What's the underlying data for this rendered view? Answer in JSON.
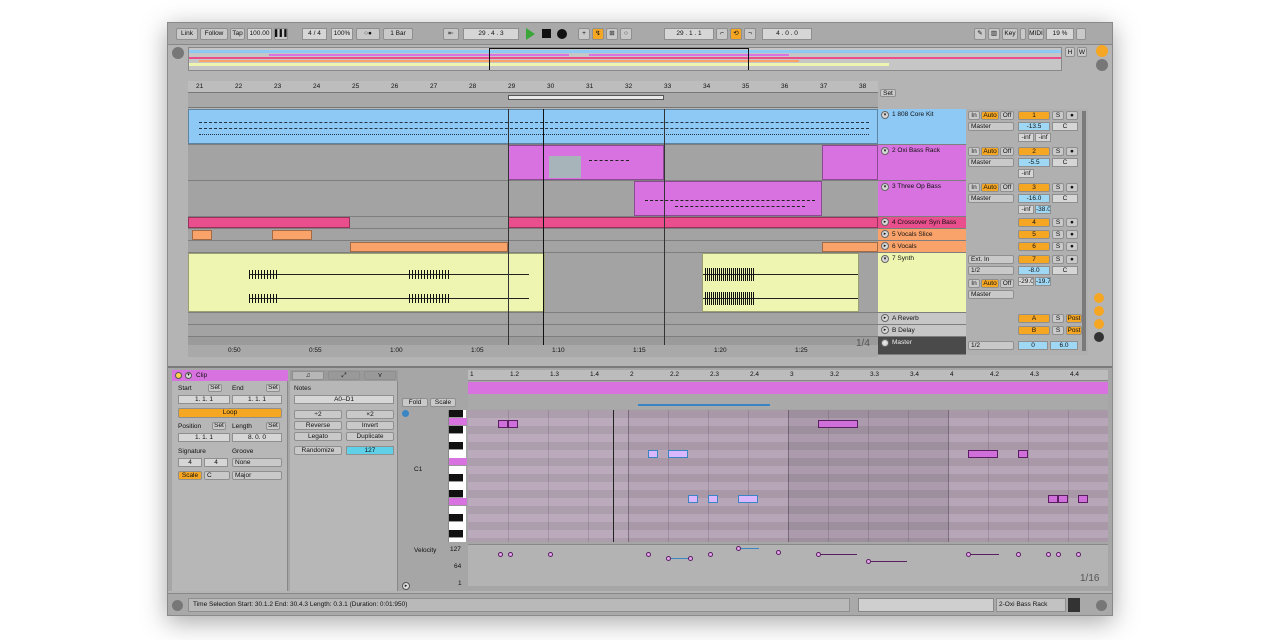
{
  "transport": {
    "link": "Link",
    "follow": "Follow",
    "tap": "Tap",
    "tempo": "100.00",
    "signature": "4 / 4",
    "zoom": "100%",
    "metro": "○●",
    "quantize": "1 Bar",
    "position": "29 .   4 .   3",
    "loop_start": "29 .   1 .   1",
    "loop_length": "4 .   0 .   0",
    "key": "Key",
    "midi": "MIDI",
    "cpu": "19 %",
    "h_label": "H",
    "w_label": "W"
  },
  "ruler": {
    "bars": [
      "21",
      "22",
      "23",
      "24",
      "25",
      "26",
      "27",
      "28",
      "29",
      "30",
      "31",
      "32",
      "33",
      "34",
      "35",
      "36",
      "37",
      "38"
    ],
    "set_label": "Set"
  },
  "tracks": [
    {
      "name": "1 808 Core Kit",
      "color": "#8ec9f5",
      "routing": "Master",
      "num": "1",
      "vol": "-13.5",
      "pan": "C",
      "meter1": "-inf",
      "meter2": "-inf"
    },
    {
      "name": "2 Oxi Bass Rack",
      "color": "#d872e0",
      "routing": "Master",
      "num": "2",
      "vol": "-5.5",
      "pan": "C",
      "meter1": "-inf",
      "meter2": ""
    },
    {
      "name": "3 Three Op Bass",
      "color": "#d872e0",
      "routing": "Master",
      "num": "3",
      "vol": "-16.0",
      "pan": "C",
      "meter1": "-inf",
      "meter2": "-38.0"
    },
    {
      "name": "4 Crossover Syn Bass",
      "color": "#e84f8c",
      "num": "4"
    },
    {
      "name": "5 Vocals Slice",
      "color": "#f9a36b",
      "num": "5"
    },
    {
      "name": "6 Vocals",
      "color": "#f9a36b",
      "num": "6"
    },
    {
      "name": "7 Synth",
      "color": "#eef5b0",
      "routing": "Ext. In",
      "sub": "1/2",
      "num": "7",
      "vol": "-8.0",
      "pan": "C",
      "meter1": "-29.0",
      "meter2": "-19.7",
      "out": "Master"
    },
    {
      "name": "A Reverb",
      "color": "#c6c6c6",
      "num": "A",
      "post": "Post"
    },
    {
      "name": "B Delay",
      "color": "#c6c6c6",
      "num": "B",
      "post": "Post"
    },
    {
      "name": "Master",
      "color": "#4a4a4a",
      "num": "0",
      "vol": "6.0",
      "sub": "1/2"
    }
  ],
  "mixer_labels": {
    "in": "In",
    "auto": "Auto",
    "off": "Off",
    "s": "S"
  },
  "timeline": {
    "marks": [
      "0:50",
      "0:55",
      "1:00",
      "1:05",
      "1:10",
      "1:15",
      "1:20",
      "1:25"
    ],
    "page": "1/4"
  },
  "clip_panel": {
    "title": "Clip",
    "start_label": "Start",
    "end_label": "End",
    "set": "Set",
    "start_val": "1.   1.   1",
    "end_val": "1.   1.   1",
    "loop": "Loop",
    "position_label": "Position",
    "length_label": "Length",
    "position_val": "1.   1.   1",
    "length_val": "8.   0.   0",
    "signature_label": "Signature",
    "groove_label": "Groove",
    "sig_num": "4",
    "sig_den": "4",
    "groove_val": "None",
    "scale_btn": "Scale",
    "scale_root": "C",
    "scale_mode": "Major"
  },
  "notes_panel": {
    "title": "Notes",
    "range": "A0–D1",
    "half": "÷2",
    "double": "×2",
    "reverse": "Reverse",
    "invert": "Invert",
    "legato": "Legato",
    "duplicate": "Duplicate",
    "randomize": "Randomize",
    "rand_val": "127"
  },
  "editor": {
    "fold": "Fold",
    "scale": "Scale",
    "c1": "C1",
    "velocity": "Velocity",
    "vel_max": "127",
    "vel_mid": "64",
    "vel_min": "1",
    "page": "1/16",
    "ruler": [
      "1",
      "1.2",
      "1.3",
      "1.4",
      "2",
      "2.2",
      "2.3",
      "2.4",
      "3",
      "3.2",
      "3.3",
      "3.4",
      "4",
      "4.2",
      "4.3",
      "4.4"
    ]
  },
  "status": {
    "text": "Time Selection   Start: 30.1.2   End: 30.4.3   Length: 0.3.1   (Duration: 0:01:950)",
    "device": "2-Oxi Bass Rack"
  }
}
